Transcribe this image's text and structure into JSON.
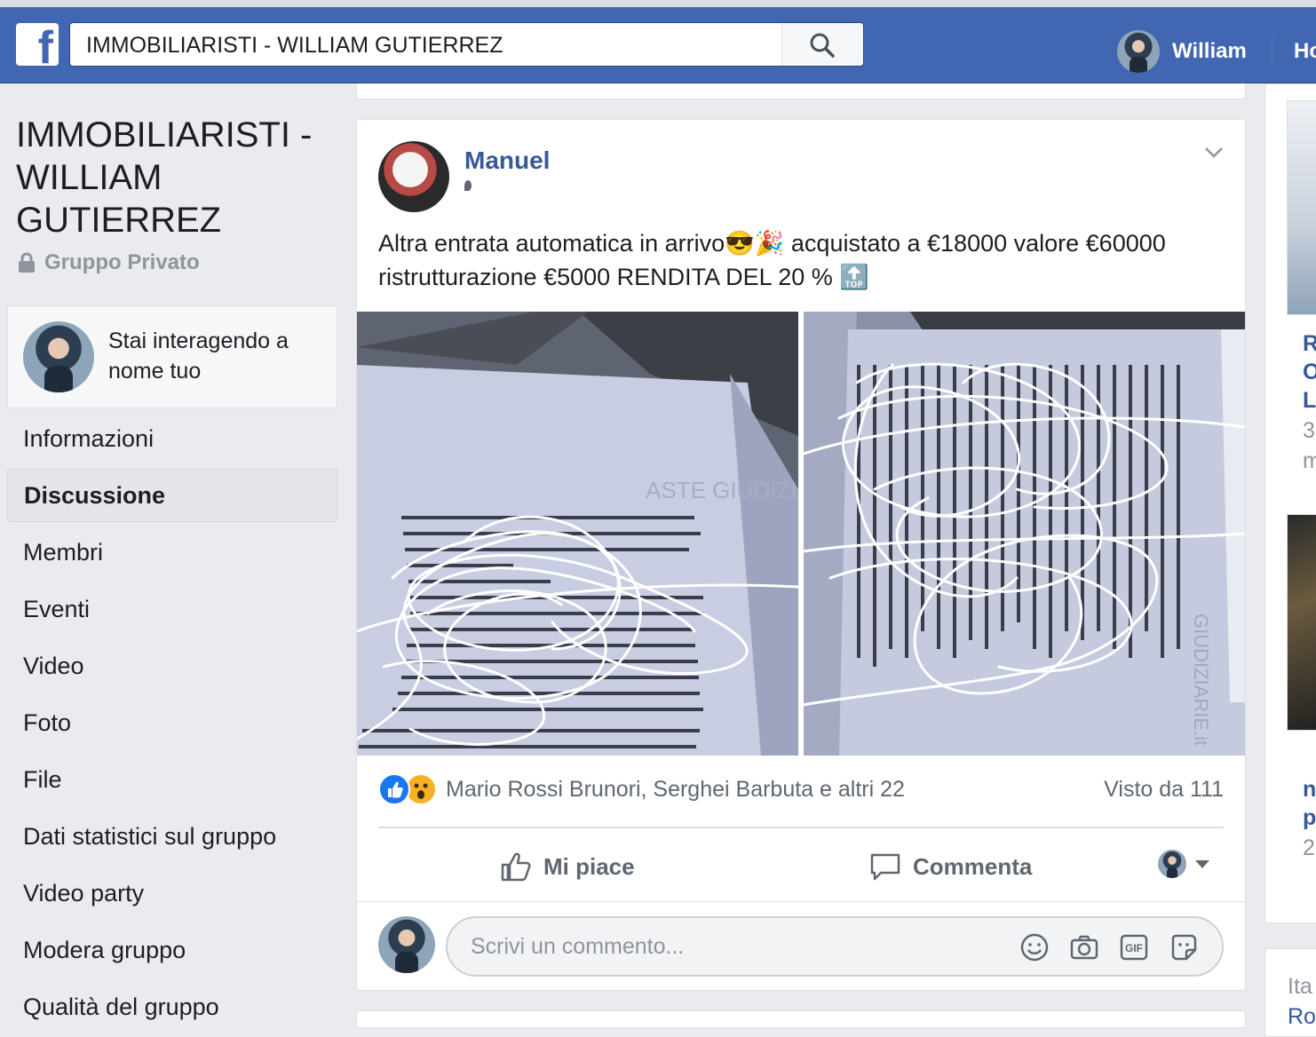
{
  "header": {
    "logo": "f",
    "search_value": "IMMOBILIARISTI - WILLIAM GUTIERREZ",
    "user_name": "William",
    "home_label": "Ho"
  },
  "group": {
    "title": "IMMOBILIARISTI - WILLIAM GUTIERREZ",
    "privacy": "Gruppo Privato",
    "interacting_as": "Stai interagendo a nome tuo"
  },
  "nav": {
    "items": [
      "Informazioni",
      "Discussione",
      "Membri",
      "Eventi",
      "Video",
      "Foto",
      "File",
      "Dati statistici sul gruppo",
      "Video party",
      "Modera gruppo",
      "Qualità del gruppo"
    ],
    "active": "Discussione"
  },
  "post": {
    "author": "Manuel",
    "text": "Altra entrata automatica in arrivo😎🎉 acquistato a €18000 valore €60000 ristrutturazione €5000 RENDITA DEL 20 % 🔝",
    "photo1_watermark": "ASTE GIUDIZIARIE.it",
    "photo2_watermark": "GIUDIZIARIE.it",
    "reactions_text": "Mario Rossi Brunori, Serghei Barbuta e altri 22",
    "seen_text": "Visto da 111",
    "like_label": "Mi piace",
    "comment_label": "Commenta",
    "comment_placeholder": "Scrivi un commento..."
  },
  "right_column": {
    "lines_bold": [
      "R",
      "O",
      "L"
    ],
    "line_gray_1": "3",
    "line_gray_2": "m",
    "lines_bold_2": [
      "n",
      "p"
    ],
    "line_gray_3": "2",
    "bottom_gray": "Ita",
    "bottom_link": "Ro"
  },
  "colors": {
    "brand_blue": "#4267b2",
    "link_blue": "#385898",
    "background": "#e9ebee"
  }
}
